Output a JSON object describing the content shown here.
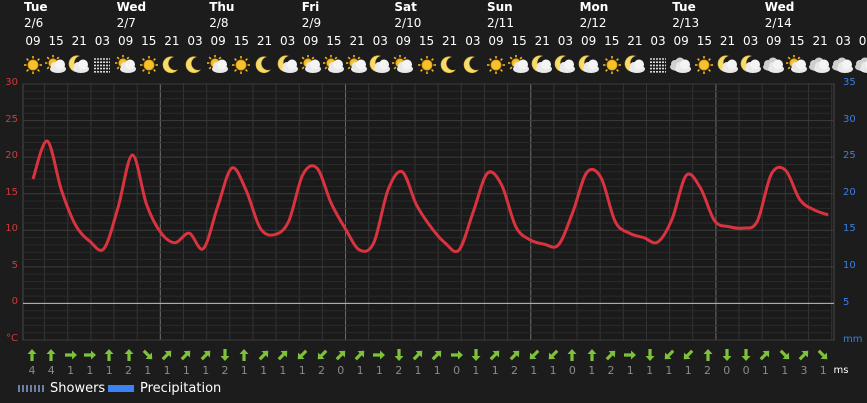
{
  "chart_data": {
    "type": "line",
    "days": [
      {
        "name": "Tue",
        "date": "2/6"
      },
      {
        "name": "Wed",
        "date": "2/7"
      },
      {
        "name": "Thu",
        "date": "2/8"
      },
      {
        "name": "Fri",
        "date": "2/9"
      },
      {
        "name": "Sat",
        "date": "2/10"
      },
      {
        "name": "Sun",
        "date": "2/11"
      },
      {
        "name": "Mon",
        "date": "2/12"
      },
      {
        "name": "Tue",
        "date": "2/13"
      },
      {
        "name": "Wed",
        "date": "2/14"
      }
    ],
    "hours": [
      "09",
      "15",
      "21",
      "03",
      "09",
      "15",
      "21",
      "03",
      "09",
      "15",
      "21",
      "03",
      "09",
      "15",
      "21",
      "03",
      "09",
      "15",
      "21",
      "03",
      "09",
      "15",
      "21",
      "03",
      "09",
      "15",
      "21",
      "03",
      "09",
      "15",
      "21",
      "03",
      "09",
      "15",
      "21",
      "03",
      "09",
      "15",
      "21"
    ],
    "weather_icons": [
      "sun",
      "partly-cloudy",
      "moon-cloud",
      "fog",
      "partly-cloudy",
      "sun",
      "moon",
      "moon",
      "partly-cloudy",
      "sun",
      "moon",
      "moon-cloud",
      "partly-cloudy",
      "partly-cloudy",
      "partly-cloudy",
      "moon-cloud",
      "partly-cloudy",
      "sun",
      "moon",
      "moon",
      "sun",
      "partly-cloudy",
      "moon-cloud",
      "moon-cloud",
      "moon-cloud",
      "sun",
      "moon-cloud",
      "fog",
      "cloudy",
      "sun",
      "moon-cloud",
      "moon-cloud",
      "cloudy",
      "partly-cloudy",
      "cloudy",
      "cloudy",
      "cloudy",
      "cloudy",
      "cloudy"
    ],
    "temperature_c": [
      17,
      22.2,
      15.5,
      10.7,
      8.5,
      7.5,
      13.2,
      20.3,
      13.5,
      9.7,
      8.3,
      9.6,
      7.5,
      13.2,
      18.5,
      15.5,
      10.3,
      9.4,
      11.2,
      17.6,
      18.5,
      13.7,
      10.2,
      7.3,
      8.3,
      15.5,
      18,
      13.5,
      10.5,
      8.3,
      7.3,
      12.5,
      17.8,
      16.2,
      10.5,
      8.7,
      8.1,
      8.0,
      12.4,
      17.9,
      17.2,
      11.2,
      9.6,
      9.0,
      8.4,
      11.5,
      17.5,
      15.8,
      11.3,
      10.5,
      10.3,
      11.2,
      17.7,
      18.2,
      14.2,
      12.8,
      12.1
    ],
    "temp_axis": {
      "unit": "°C",
      "ylim": [
        -5,
        30
      ],
      "ticks": [
        30,
        25,
        20,
        15,
        10,
        5,
        0
      ]
    },
    "precip_axis": {
      "unit": "mm",
      "ticks": [
        35,
        30,
        25,
        20,
        15,
        10,
        5
      ]
    },
    "wind": {
      "unit": "ms",
      "speeds": [
        "4",
        "4",
        "1",
        "1",
        "1",
        "2",
        "1",
        "1",
        "1",
        "1",
        "2",
        "1",
        "1",
        "1",
        "1",
        "2",
        "0",
        "1",
        "1",
        "2",
        "1",
        "1",
        "0",
        "1",
        "1",
        "2",
        "1",
        "1",
        "0",
        "1",
        "2",
        "1",
        "1",
        "1",
        "1",
        "2",
        "0",
        "0",
        "1",
        "1",
        "3",
        "1"
      ],
      "directions": [
        "up",
        "up",
        "right",
        "right",
        "up",
        "up",
        "down-right",
        "up-right",
        "up-right",
        "up-right",
        "down",
        "up",
        "up-right",
        "up-right",
        "down-left",
        "down-left",
        "up-right",
        "up-right",
        "right",
        "down",
        "up-right",
        "up-right",
        "right",
        "down",
        "up-right",
        "up-right",
        "down-left",
        "down-left",
        "up",
        "up",
        "up-right",
        "right",
        "down",
        "down-left",
        "down-left",
        "up",
        "down",
        "down",
        "up-right",
        "down-right",
        "up-right",
        "down-right"
      ]
    },
    "legend": [
      {
        "name": "Showers",
        "color": "#6b7fa8",
        "style": "dotted"
      },
      {
        "name": "Precipitation",
        "color": "#3b82f6",
        "style": "solid"
      }
    ],
    "colors": {
      "temperature": "#d93340",
      "wind_arrow": "#7ec23b",
      "zero_line": "#bdbdbd"
    },
    "grid": true
  }
}
